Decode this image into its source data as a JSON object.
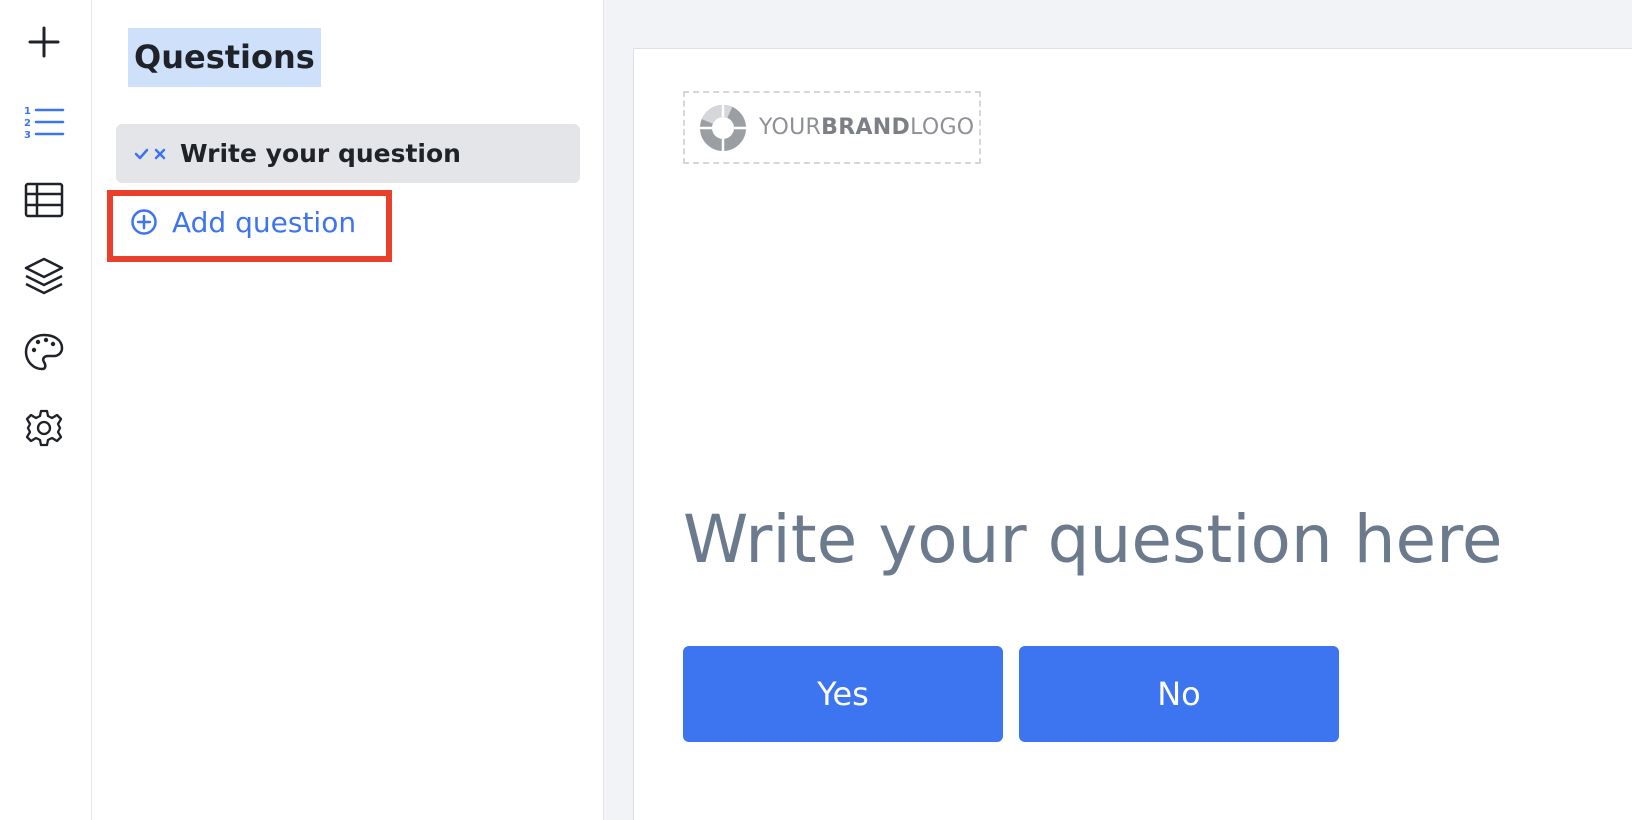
{
  "rail": {
    "items": [
      {
        "icon": "plus-icon"
      },
      {
        "icon": "numbered-list-icon",
        "active": true
      },
      {
        "icon": "table-icon"
      },
      {
        "icon": "layers-icon"
      },
      {
        "icon": "palette-icon"
      },
      {
        "icon": "gear-icon"
      }
    ]
  },
  "panel": {
    "title": "Questions",
    "questions": [
      {
        "label": "Write your question",
        "type_icon": "yes-no-icon"
      }
    ],
    "add_label": "Add question"
  },
  "preview": {
    "logo": {
      "part1": "YOUR",
      "part2": "BRAND",
      "part3": "LOGO"
    },
    "question": "Write your question here",
    "answers": [
      "Yes",
      "No"
    ]
  },
  "colors": {
    "accent": "#3d74f0",
    "highlight": "#e8402b",
    "title_highlight": "#cfe0fb",
    "question_text": "#6c7a8d"
  }
}
